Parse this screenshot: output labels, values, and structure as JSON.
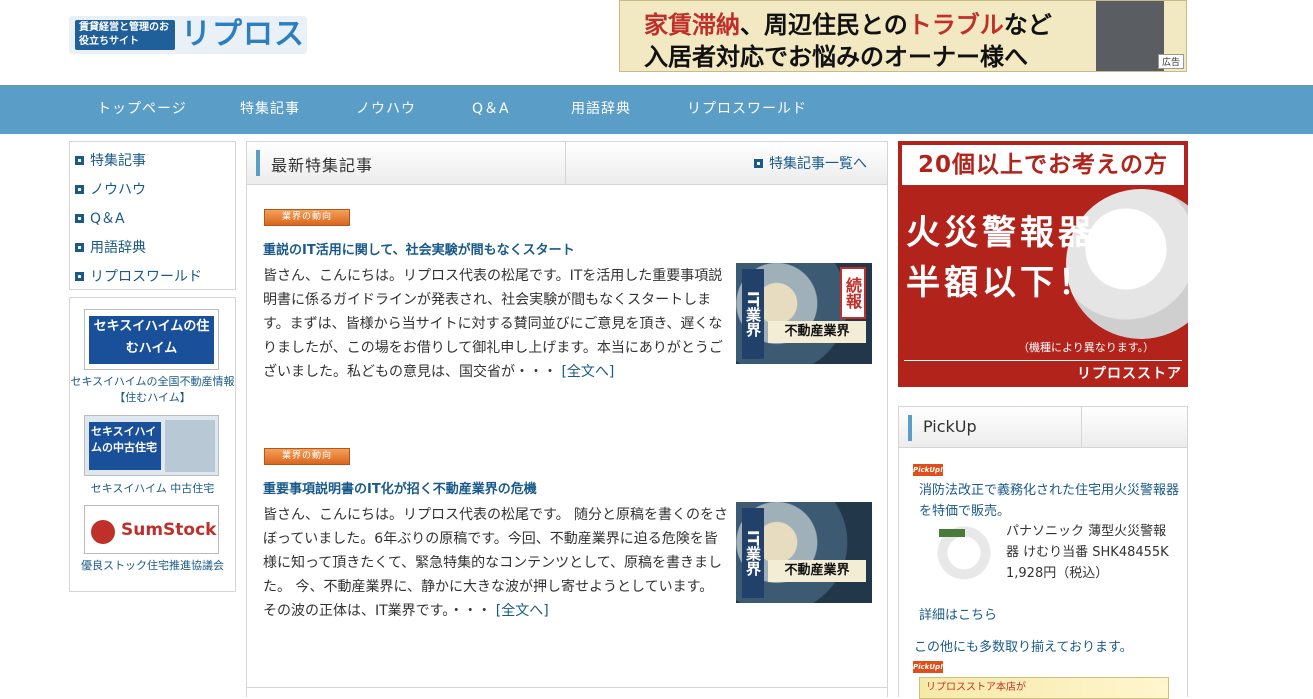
{
  "header": {
    "logo_tag": "賃貸経営と管理のお役立ちサイト",
    "logo_name": "リプロス",
    "banner_line1_a": "家賃滞納",
    "banner_line1_b": "、周辺住民との",
    "banner_line1_c": "トラブル",
    "banner_line1_d": "など",
    "banner_line2": "入居者対応でお悩みのオーナー様へ",
    "banner_ad": "広告"
  },
  "nav": [
    "トップページ",
    "特集記事",
    "ノウハウ",
    "Q＆A",
    "用語辞典",
    "リプロスワールド"
  ],
  "left_menu": [
    "特集記事",
    "ノウハウ",
    "Q＆A",
    "用語辞典",
    "リプロスワールド"
  ],
  "left_ads": [
    {
      "image_text": "セキスイハイムの住むハイム",
      "caption": "セキスイハイムの全国不動産情報【住むハイム】"
    },
    {
      "image_text": "セキスイハイムの中古住宅",
      "caption": "セキスイハイム 中古住宅"
    },
    {
      "image_text": "SumStock",
      "caption": "優良ストック住宅推進協議会"
    }
  ],
  "main": {
    "heading": "最新特集記事",
    "more_link": "特集記事一覧へ",
    "articles": [
      {
        "badge": "業界の動向",
        "title": "重説のIT活用に関して、社会実験が間もなくスタート",
        "body": "皆さん、こんにちは。リプロス代表の松尾です。ITを活用した重要事項説明書に係るガイドラインが発表され、社会実験が間もなくスタートします。まずは、皆様から当サイトに対する賛同並びにご意見を頂き、遅くなりましたが、この場をお借りして御礼申し上げます。本当にありがとうございました。私どもの意見は、国交省が・・・",
        "more": "[全文へ]",
        "img_it": "IT業界",
        "img_extra": "続報",
        "img_fd": "不動産業界"
      },
      {
        "badge": "業界の動向",
        "title": "重要事項説明書のIT化が招く不動産業界の危機",
        "body": "皆さん、こんにちは。リプロス代表の松尾です。 随分と原稿を書くのをさぼっていました。6年ぶりの原稿です。今回、不動産業界に迫る危険を皆様に知って頂きたくて、緊急特集的なコンテンツとして、原稿を書きました。 今、不動産業界に、静かに大きな波が押し寄せようとしています。 その波の正体は、IT業界です。・・・",
        "more": "[全文へ]",
        "img_it": "IT業界",
        "img_fd": "不動産業界"
      }
    ]
  },
  "fire_banner": {
    "top": "20個以上でお考えの方",
    "big1": "火災警報器",
    "big2": "半額以下！",
    "note": "（機種により異なります。）",
    "store": "リプロスストア"
  },
  "pickup": {
    "heading": "PickUp",
    "tag": "PickUp!",
    "intro": "消防法改正で義務化された住宅用火災警報器を特価で販売。",
    "product": "パナソニック 薄型火災警報器 けむり当番 SHK48455K",
    "price": "1,928円（税込）",
    "detail": "詳細はこちら",
    "more": "この他にも多数取り揃えております。",
    "bottom_banner": "リプロスストア本店が"
  },
  "colors": {
    "nav": "#5a9ec7",
    "link": "#1a5a8a",
    "fire": "#b2231c"
  }
}
